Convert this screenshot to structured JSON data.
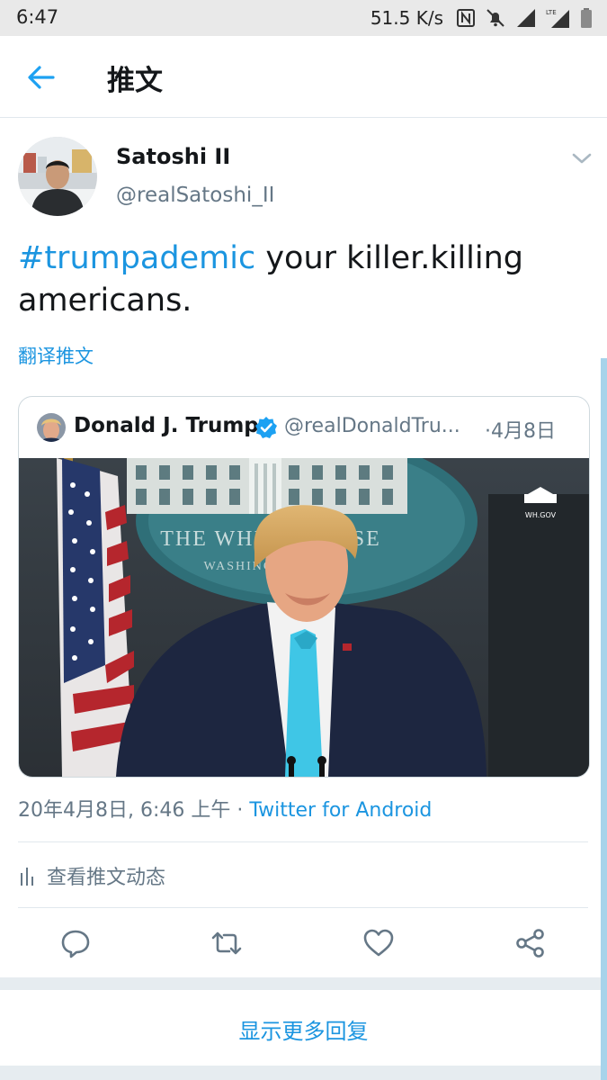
{
  "status_bar": {
    "time": "6:47",
    "network_speed": "51.5 K/s",
    "icons": [
      "nfc-icon",
      "bell-muted-icon",
      "signal-icon",
      "lte-signal-icon",
      "battery-icon"
    ],
    "lte_label": "LTE"
  },
  "header": {
    "title": "推文",
    "back_icon": "arrow-left-icon"
  },
  "tweet": {
    "author_name": "Satoshi II",
    "author_handle": "@realSatoshi_II",
    "hashtag": "#trumpademic",
    "text": " your killer.killing americans.",
    "translate_label": "翻译推文",
    "timestamp": "20年4月8日, 6:46 上午 · ",
    "source": "Twitter for Android",
    "activity_label": "查看推文动态"
  },
  "quoted_tweet": {
    "author_name": "Donald J. Trump",
    "author_handle": "@realDonaldTru...",
    "date": "·4月8日",
    "verified": true,
    "image": {
      "backdrop_text": "THE WHITE HOUSE",
      "backdrop_subtext": "WASHINGTON",
      "watermark": "WH.GOV"
    }
  },
  "actions": [
    "reply-icon",
    "retweet-icon",
    "like-icon",
    "share-icon"
  ],
  "footer": {
    "more_replies_label": "显示更多回复"
  },
  "colors": {
    "accent": "#1b95e0",
    "secondary_text": "#657786",
    "divider": "#e1e8ed",
    "band": "#e6ecf0",
    "status_bar": "#e9e9e9"
  }
}
